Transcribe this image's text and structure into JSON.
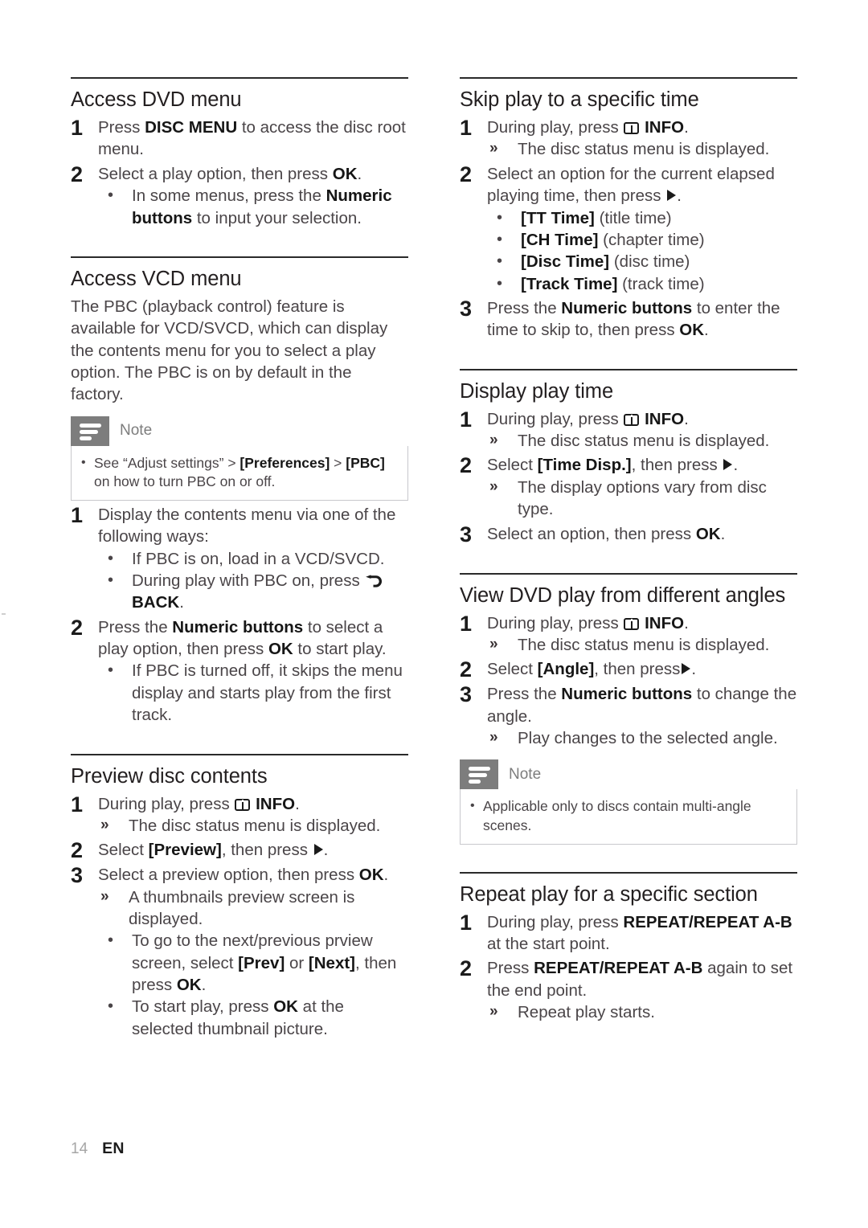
{
  "document": {
    "footer": {
      "page_number": "14",
      "language": "EN"
    },
    "note_label": "Note"
  },
  "left_column": {
    "sections": [
      {
        "heading": "Access DVD menu",
        "steps": [
          {
            "num": "1",
            "text_html": "Press <b>DISC MENU</b> to access the disc root menu."
          },
          {
            "num": "2",
            "text_html": "Select a play option, then press <b>OK</b>.",
            "bullets": [
              "In some menus, press the <b>Numeric buttons</b> to input your selection."
            ]
          }
        ]
      },
      {
        "heading": "Access VCD menu",
        "paragraph": "The PBC (playback control) feature is available for VCD/SVCD, which can display the contents menu for you to select a play option. The PBC is on by default in the factory.",
        "note": {
          "items": [
            "See “Adjust settings” > <b>[Preferences]</b> > <b>[PBC]</b> on how to turn PBC on or off."
          ]
        },
        "steps": [
          {
            "num": "1",
            "text_html": "Display the contents menu via one of the following ways:",
            "bullets": [
              "If PBC is on, load in a VCD/SVCD.",
              "During play with PBC on, press <ICON-BACK> <b>BACK</b>."
            ]
          },
          {
            "num": "2",
            "text_html": "Press the <b>Numeric buttons</b> to select a play option, then press <b>OK</b> to start play.",
            "bullets": [
              "If PBC is turned off, it skips the menu display and starts play from the first track."
            ]
          }
        ]
      },
      {
        "heading": "Preview disc contents",
        "steps": [
          {
            "num": "1",
            "text_html": "During play, press <ICON-INFO> <b>INFO</b>.",
            "arrows": [
              "The disc status menu is displayed."
            ]
          },
          {
            "num": "2",
            "text_html": "Select <b>[Preview]</b>, then press <ICON-PLAY>."
          },
          {
            "num": "3",
            "text_html": "Select a preview option, then press <b>OK</b>.",
            "arrows": [
              "A thumbnails preview screen is displayed."
            ],
            "bullets": [
              "To go to the next/previous prview screen, select <b>[Prev]</b> or <b>[Next]</b>, then press <b>OK</b>.",
              "To start play, press <b>OK</b> at the selected thumbnail picture."
            ]
          }
        ]
      }
    ]
  },
  "right_column": {
    "sections": [
      {
        "heading": "Skip play to a specific time",
        "steps": [
          {
            "num": "1",
            "text_html": "During play, press <ICON-INFO> <b>INFO</b>.",
            "arrows": [
              "The disc status menu is displayed."
            ]
          },
          {
            "num": "2",
            "text_html": "Select an option for the current elapsed playing time, then press <ICON-PLAY>.",
            "bullets": [
              "<b>[TT Time]</b> (title time)",
              "<b>[CH Time]</b> (chapter time)",
              "<b>[Disc Time]</b> (disc time)",
              "<b>[Track Time]</b> (track time)"
            ]
          },
          {
            "num": "3",
            "text_html": "Press the <b>Numeric buttons</b> to enter the time to skip to, then press <b>OK</b>."
          }
        ]
      },
      {
        "heading": "Display play time",
        "steps": [
          {
            "num": "1",
            "text_html": "During play, press <ICON-INFO> <b>INFO</b>.",
            "arrows": [
              "The disc status menu is displayed."
            ]
          },
          {
            "num": "2",
            "text_html": "Select <b>[Time Disp.]</b>, then press <ICON-PLAY>.",
            "arrows": [
              "The display options vary from disc type."
            ]
          },
          {
            "num": "3",
            "text_html": "Select an option, then press <b>OK</b>."
          }
        ]
      },
      {
        "heading": "View DVD play from different angles",
        "steps": [
          {
            "num": "1",
            "text_html": "During play, press <ICON-INFO> <b>INFO</b>.",
            "arrows": [
              "The disc status menu is displayed."
            ]
          },
          {
            "num": "2",
            "text_html": "Select <b>[Angle]</b>, then press<ICON-PLAY>."
          },
          {
            "num": "3",
            "text_html": "Press the <b>Numeric buttons</b> to change the angle.",
            "arrows": [
              "Play changes to the selected angle."
            ]
          }
        ],
        "note": {
          "items": [
            "Applicable only to discs contain multi-angle scenes."
          ]
        }
      },
      {
        "heading": "Repeat play for a specific section",
        "steps": [
          {
            "num": "1",
            "text_html": "During play, press <b>REPEAT/REPEAT A-B</b> at the start point."
          },
          {
            "num": "2",
            "text_html": "Press <b>REPEAT/REPEAT A-B</b> again to set the end point.",
            "arrows": [
              "Repeat play starts."
            ]
          }
        ]
      }
    ]
  }
}
